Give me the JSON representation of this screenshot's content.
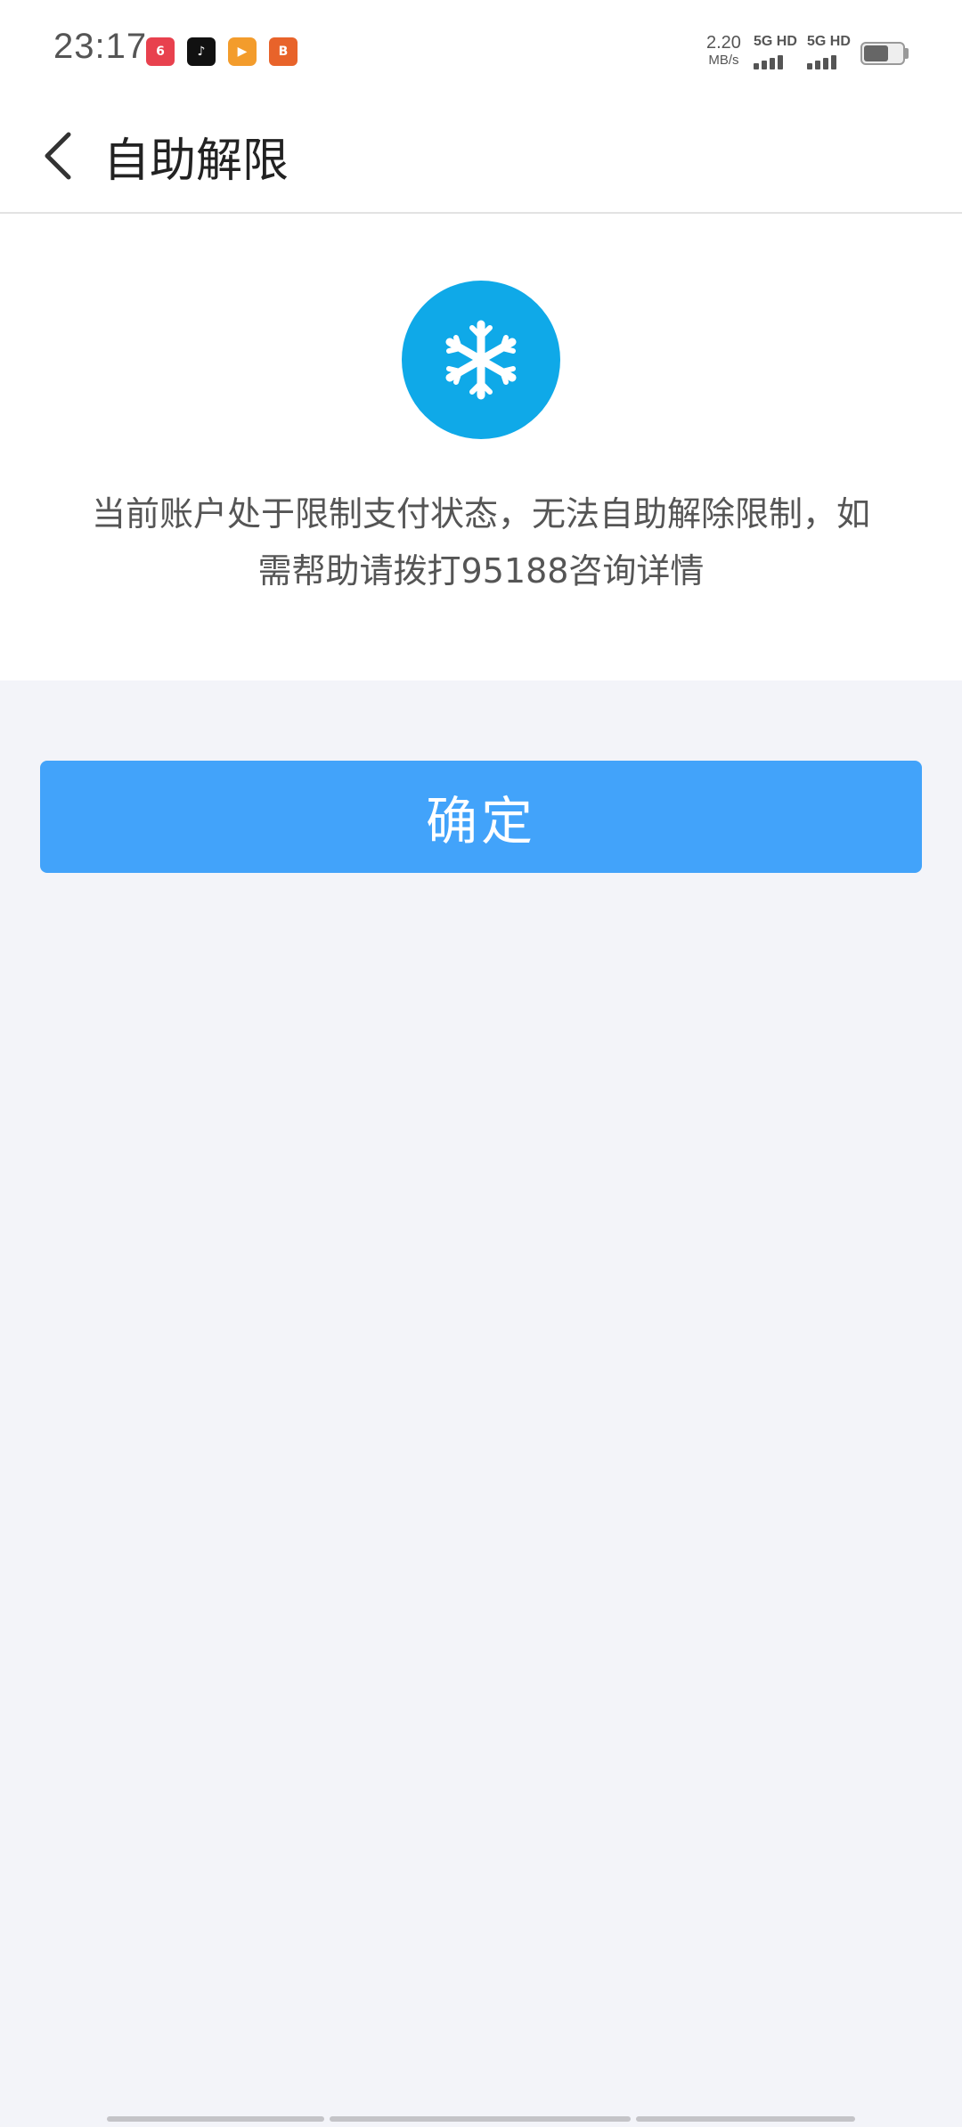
{
  "status_bar": {
    "time": "23:17",
    "apps": [
      {
        "icon": "shopping-618-app-icon",
        "glyph": "6"
      },
      {
        "icon": "douyin-app-icon",
        "glyph": "♪"
      },
      {
        "icon": "video-app-icon",
        "glyph": "▶"
      },
      {
        "icon": "orange-app-icon",
        "glyph": "B"
      }
    ],
    "net_speed_value": "2.20",
    "net_speed_unit": "MB/s",
    "sim1_label": "5G HD",
    "sim2_label": "5G HD",
    "battery_level": 0.65
  },
  "header": {
    "back_icon": "chevron-left-icon",
    "title": "自助解限"
  },
  "content": {
    "icon": "snowflake-icon",
    "icon_color": "#0fa9e8",
    "message": "当前账户处于限制支付状态，无法自助解除限制，如需帮助请拨打95188咨询详情"
  },
  "actions": {
    "confirm_label": "确定",
    "confirm_color": "#42a3fa"
  },
  "colors": {
    "background": "#f3f4f9",
    "card": "#ffffff"
  }
}
